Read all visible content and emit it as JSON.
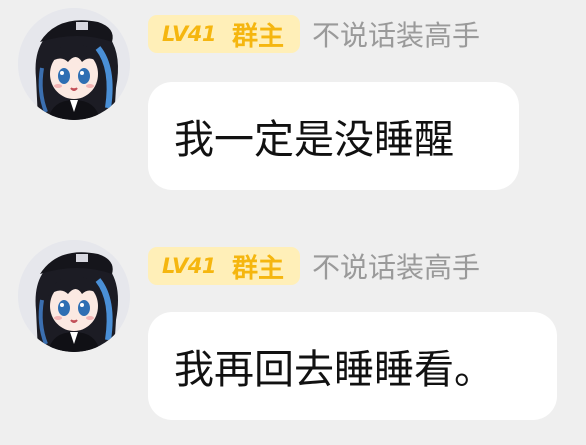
{
  "messages": [
    {
      "sender": {
        "level": "LV41",
        "role": "群主",
        "nickname": "不说话装高手",
        "avatar_icon": "anime-girl-avatar"
      },
      "text": "我一定是没睡醒"
    },
    {
      "sender": {
        "level": "LV41",
        "role": "群主",
        "nickname": "不说话装高手",
        "avatar_icon": "anime-girl-avatar"
      },
      "text": "我再回去睡睡看。"
    }
  ],
  "colors": {
    "badge_background": "#ffefb8",
    "badge_text": "#f5b60f",
    "nickname": "#9a9a9a",
    "bubble": "#ffffff",
    "chat_background": "#efefef"
  }
}
